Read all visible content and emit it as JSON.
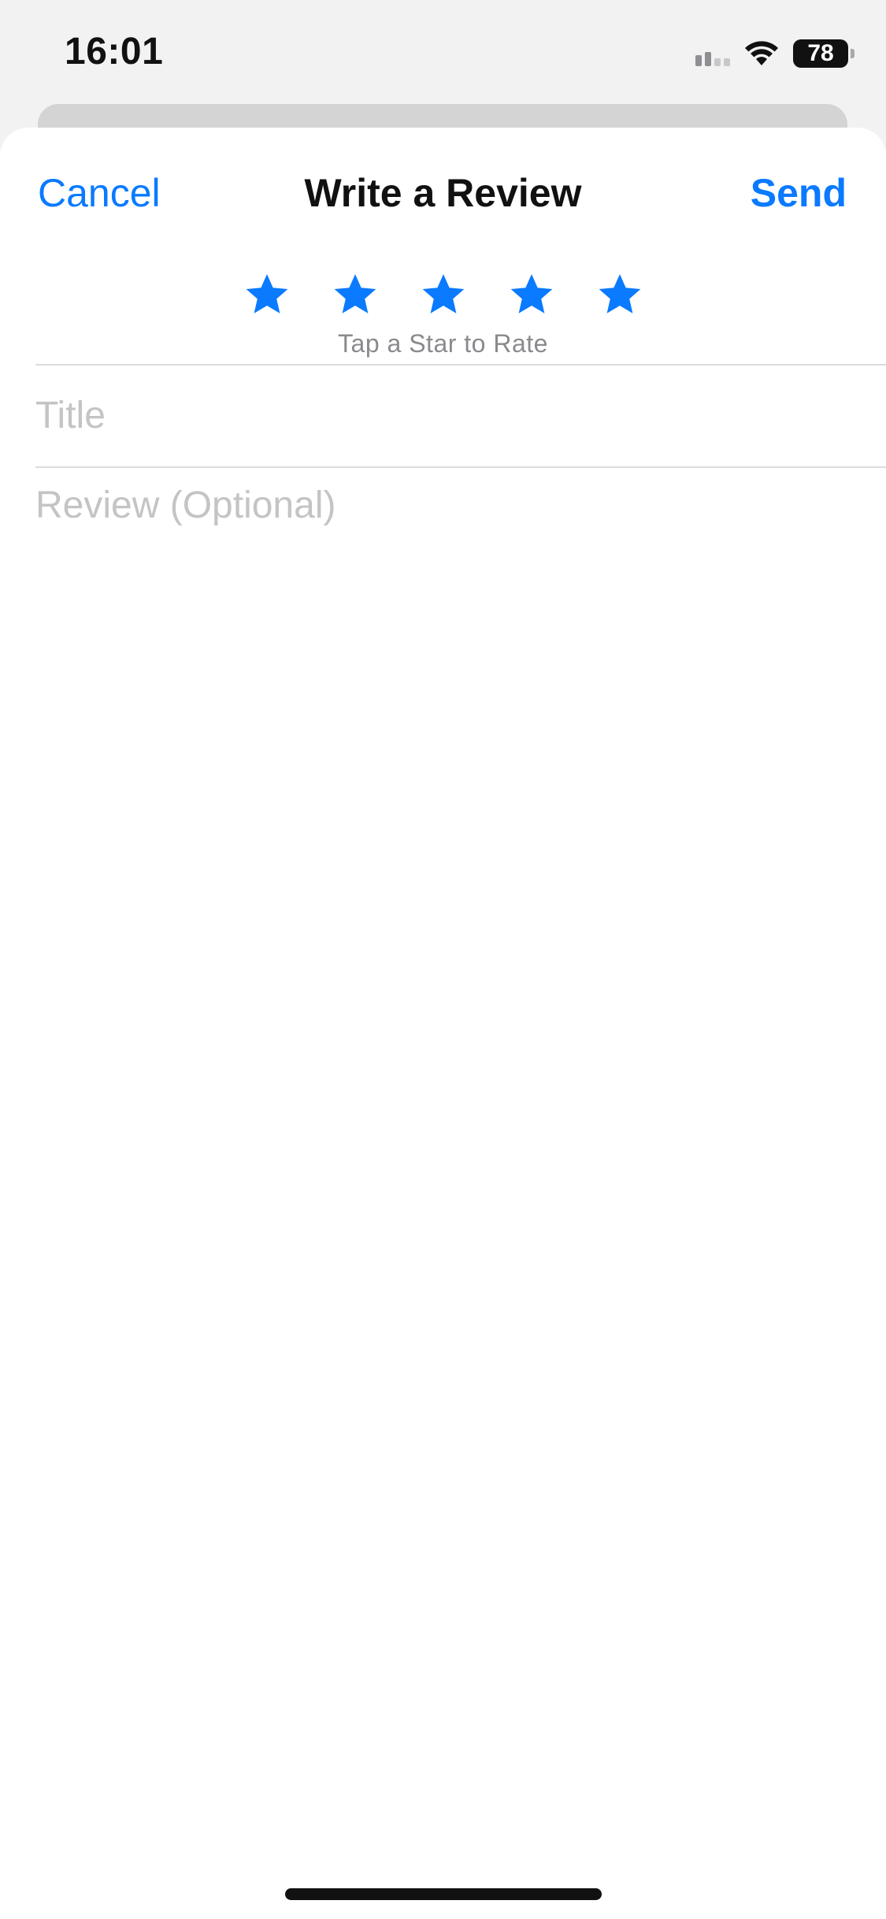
{
  "status_bar": {
    "time": "16:01",
    "battery_level": "78"
  },
  "nav": {
    "cancel_label": "Cancel",
    "title": "Write a Review",
    "send_label": "Send"
  },
  "rating": {
    "hint": "Tap a Star to Rate",
    "stars_total": 5,
    "star_color": "#0a7aff",
    "star_icon": "star-icon"
  },
  "form": {
    "title_placeholder": "Title",
    "title_value": "",
    "review_placeholder": "Review (Optional)",
    "review_value": ""
  },
  "colors": {
    "accent": "#0a7aff",
    "placeholder": "#c4c4c6",
    "hint": "#8a8a8e"
  }
}
